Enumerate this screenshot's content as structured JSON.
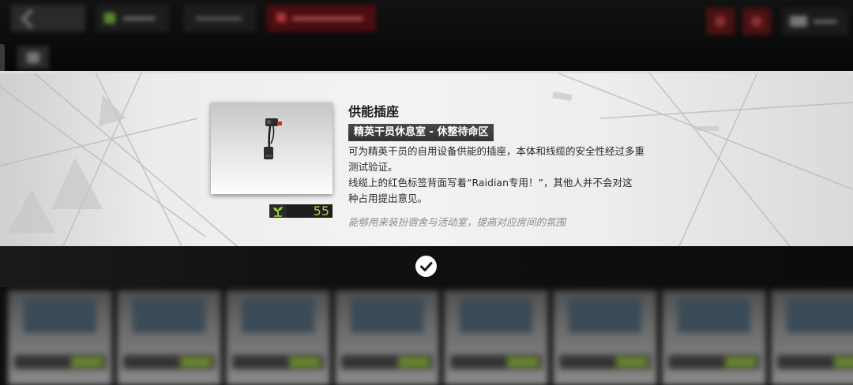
{
  "item": {
    "name": "供能插座",
    "tag": "精英干员休息室 - 休整待命区",
    "description": [
      "可为精英干员的自用设备供能的插座，本体和线缆的安全性经过多重",
      "测试验证。",
      "线缆上的红色标签背面写着“Raidian专用！”，其他人并不会对这",
      "种占用提出意见。"
    ],
    "flavor": "能够用来装扮宿舍与活动室，提高对应房间的氛围",
    "comfort_value": "55",
    "comfort_icon": "plant-icon"
  },
  "confirm": {
    "icon": "checkmark-icon"
  },
  "colors": {
    "comfort_green": "#a4d93b",
    "panel_bg": "#eeeeee",
    "tag_bg": "#3a3a3a"
  }
}
